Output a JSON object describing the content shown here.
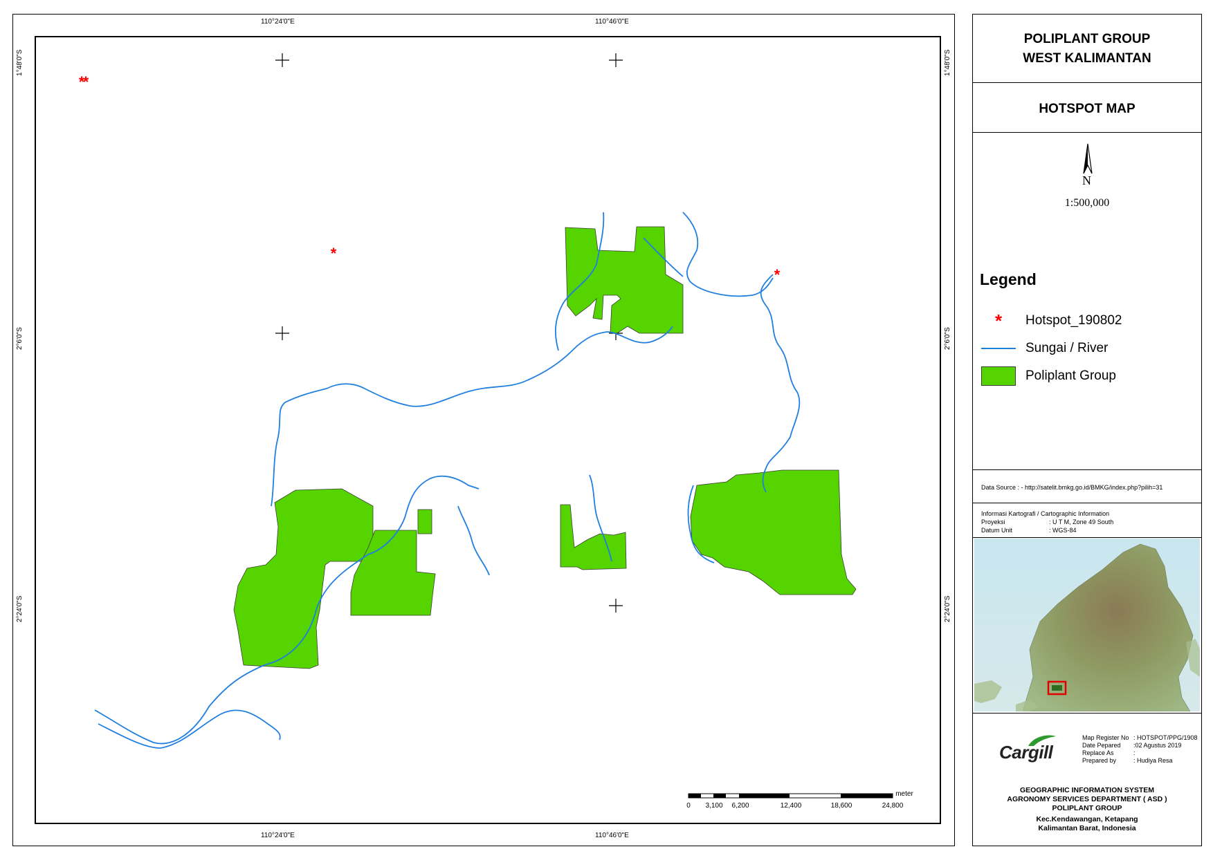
{
  "map": {
    "coords": {
      "top_lon": [
        "110°24'0\"E",
        "110°46'0\"E"
      ],
      "bottom_lon": [
        "110°24'0\"E",
        "110°46'0\"E"
      ],
      "lat_left": [
        "1°48'0\"S",
        "2°6'0\"S",
        "2°24'0\"S"
      ],
      "lat_right": [
        "1°48'0\"S",
        "2°6'0\"S",
        "2°24'0\"S"
      ]
    },
    "scalebar": {
      "unit": "meter",
      "labels": [
        "0",
        "3,100",
        "6,200",
        "12,400",
        "18,600",
        "24,800"
      ]
    },
    "colors": {
      "concession": "#55d400",
      "river": "#1f7fe0",
      "hotspot": "#ff0000"
    }
  },
  "panel": {
    "title_line1": "POLIPLANT GROUP",
    "title_line2": "WEST KALIMANTAN",
    "map_type": "HOTSPOT MAP",
    "north_label": "N",
    "scale": "1:500,000",
    "legend": {
      "heading": "Legend",
      "items": [
        "Hotspot_190802",
        "Sungai / River",
        "Poliplant Group"
      ]
    },
    "data_source": "Data Source :   - http://satelit.bmkg.go.id/BMKG/index.php?pilih=31",
    "carto": {
      "heading": "Informasi Kartografi / Cartographic Information",
      "rows": [
        {
          "label": "Proyeksi",
          "value": ": U T M, Zone 49 South"
        },
        {
          "label": "Datum Unit",
          "value": ": WGS-84"
        }
      ]
    },
    "logo_text": "Cargill",
    "register": [
      {
        "label": "Map Register No",
        "value": ": HOTSPOT/PPG/1908"
      },
      {
        "label": "Date Pepared",
        "value": ":02 Agustus 2019"
      },
      {
        "label": "Replace As",
        "value": ":"
      },
      {
        "label": "Prepared by",
        "value": ": Hudiya Resa"
      }
    ],
    "gis_lines": [
      "GEOGRAPHIC INFORMATION SYSTEM",
      "AGRONOMY SERVICES DEPARTMENT ( ASD )",
      "POLIPLANT GROUP",
      "Kec.Kendawangan, Ketapang",
      "Kalimantan Barat, Indonesia"
    ]
  }
}
